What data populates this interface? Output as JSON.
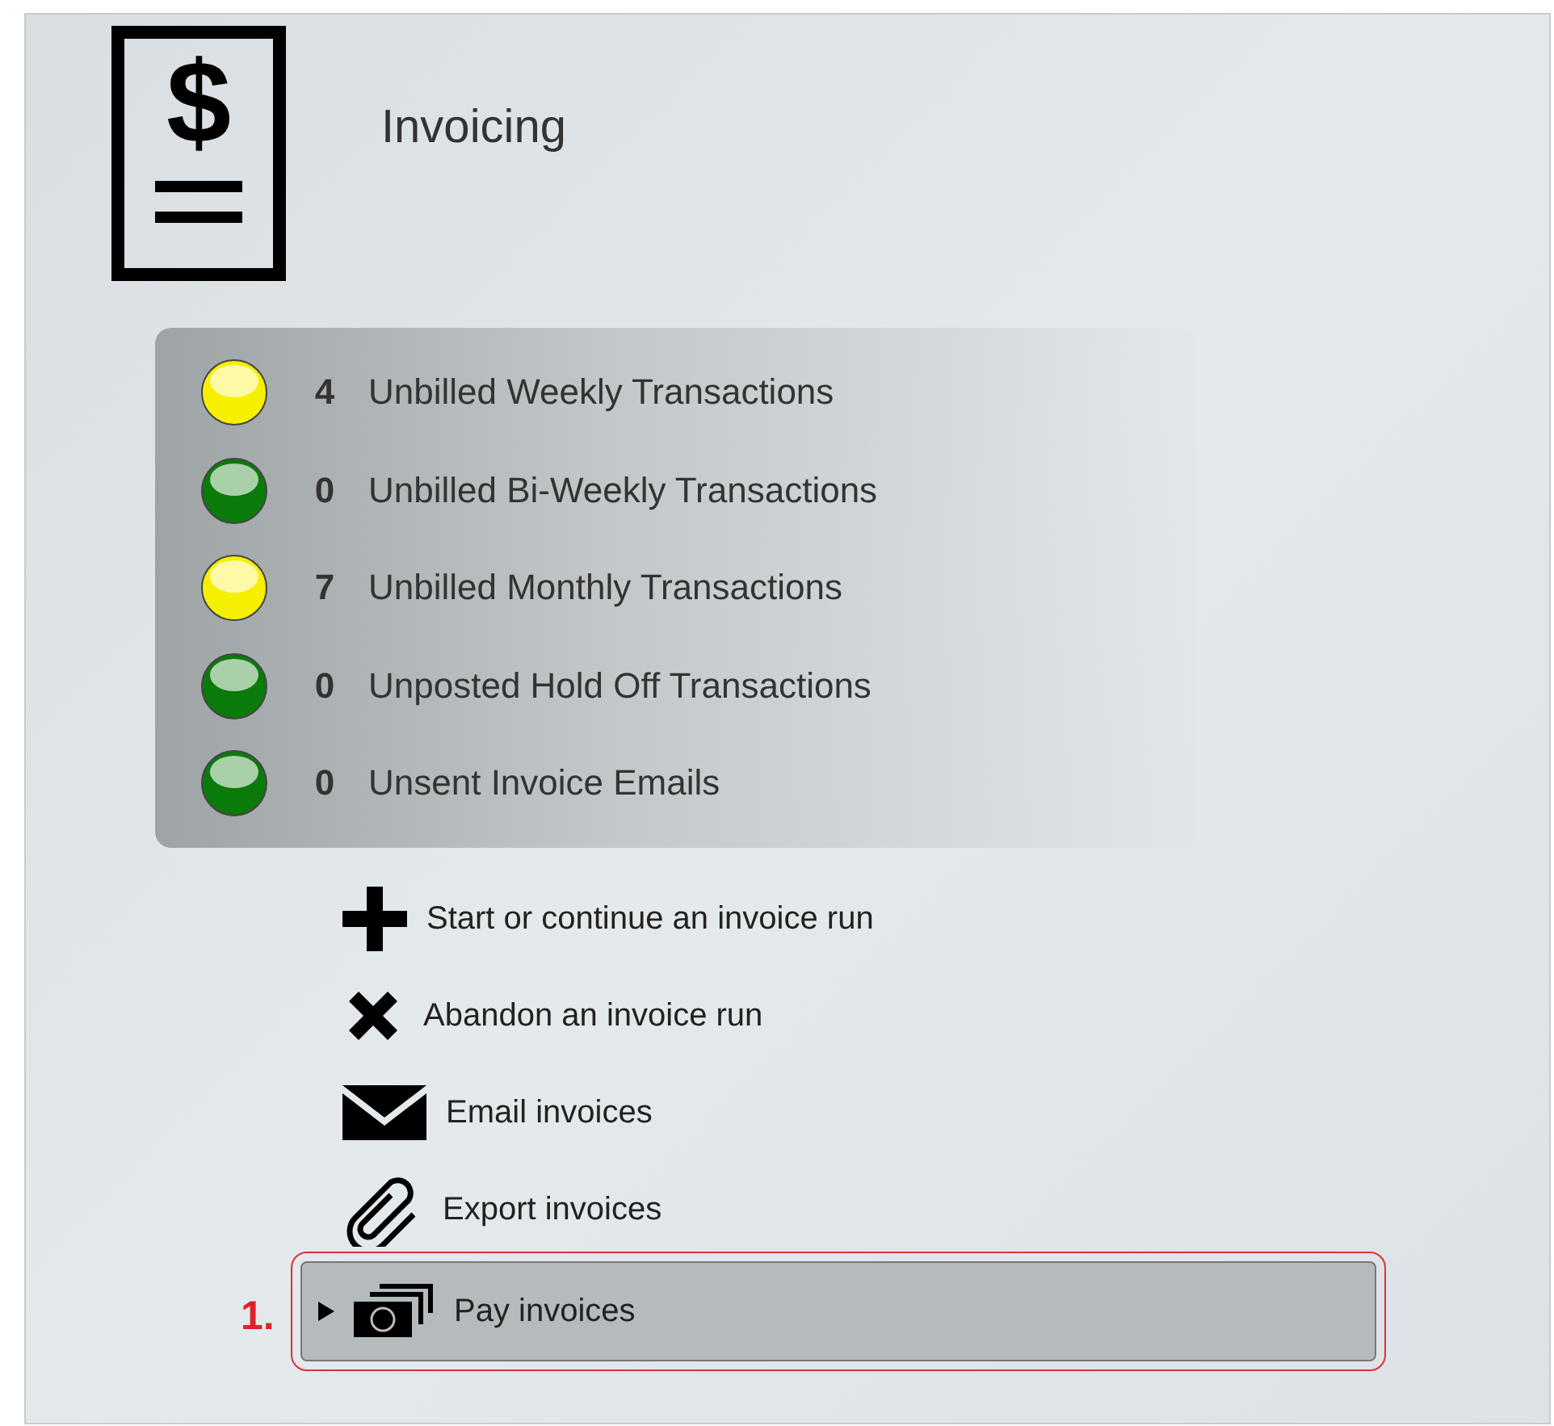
{
  "header": {
    "logo_glyph": "$",
    "title": "Invoicing"
  },
  "status_items": [
    {
      "color": "#f5f000",
      "count": "4",
      "label": "Unbilled Weekly Transactions"
    },
    {
      "color": "#0a7a0a",
      "count": "0",
      "label": "Unbilled Bi-Weekly Transactions"
    },
    {
      "color": "#f5f000",
      "count": "7",
      "label": "Unbilled Monthly Transactions"
    },
    {
      "color": "#0a7a0a",
      "count": "0",
      "label": "Unposted Hold Off Transactions"
    },
    {
      "color": "#0a7a0a",
      "count": "0",
      "label": "Unsent Invoice Emails"
    }
  ],
  "actions": [
    {
      "kind": "plus",
      "label": "Start or continue an invoice run",
      "selected": false
    },
    {
      "kind": "cross",
      "label": "Abandon an invoice run",
      "selected": false
    },
    {
      "kind": "mail",
      "label": "Email invoices",
      "selected": false
    },
    {
      "kind": "clip",
      "label": "Export invoices",
      "selected": false
    },
    {
      "kind": "cash",
      "label": "Pay invoices",
      "selected": true,
      "annotation": "1."
    }
  ]
}
